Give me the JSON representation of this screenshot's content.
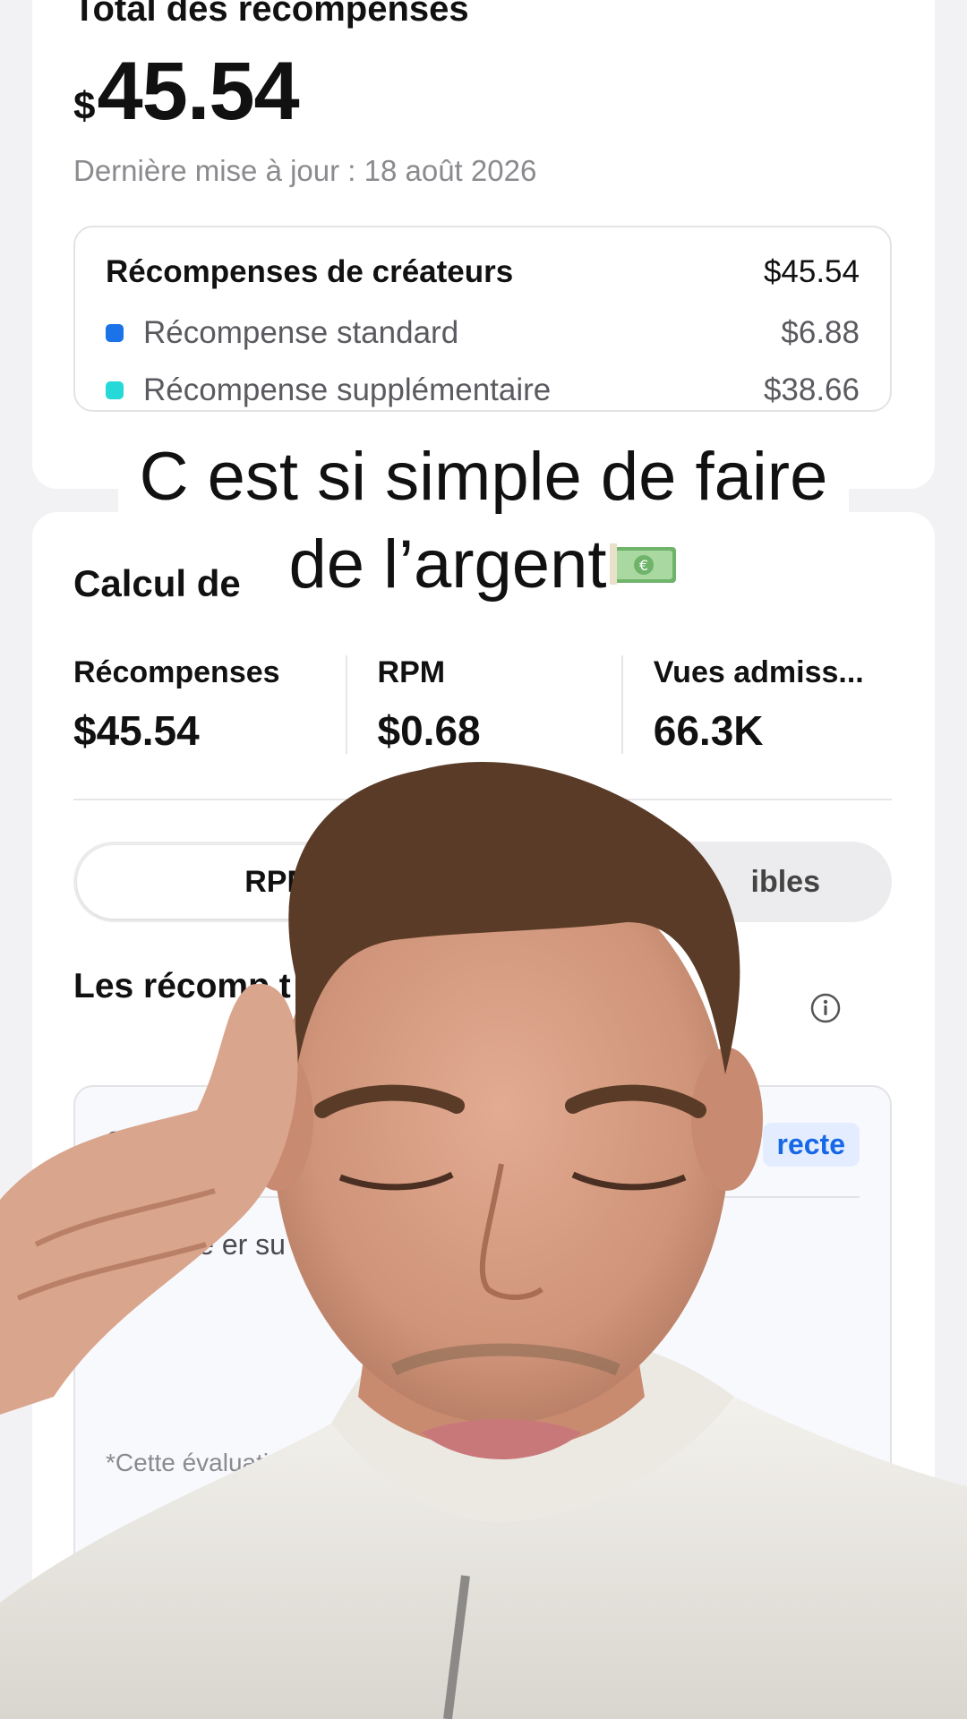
{
  "totals": {
    "title": "Total des récompenses",
    "currency_symbol": "$",
    "amount": "45.54",
    "updated": "Dernière mise à jour : 18 août 2026"
  },
  "breakdown": {
    "header_label": "Récompenses de créateurs",
    "header_amount": "$45.54",
    "items": [
      {
        "label": "Récompense standard",
        "amount": "$6.88",
        "color": "#1a73e8"
      },
      {
        "label": "Récompense supplémentaire",
        "amount": "$38.66",
        "color": "#25d9d9"
      }
    ]
  },
  "calc": {
    "title": "Calcul de",
    "stats": [
      {
        "label": "Récompenses",
        "value": "$45.54"
      },
      {
        "label": "RPM",
        "value": "$0.68"
      },
      {
        "label": "Vues admiss...",
        "value": "66.3K"
      }
    ],
    "tabs": {
      "active": "RPM",
      "other": "ibles"
    },
    "heading": "Les récomp                                        t augmenté t",
    "evaluation": {
      "tag": "e",
      "badge": "recte",
      "body": "                                      voie        ir                                             te       er su                                       de la    ration et de",
      "note": "*Cette évaluation                                                       t. La précision"
    }
  },
  "overlay_caption": {
    "line1": "C est si simple de faire",
    "line2": "de l’argent"
  }
}
